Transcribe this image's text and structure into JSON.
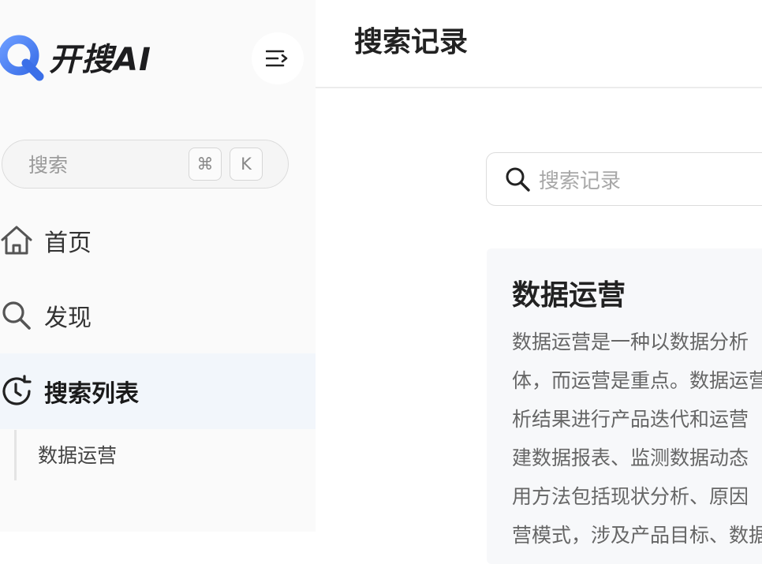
{
  "brand": {
    "name": "开搜AI",
    "accent": "#4a7df0"
  },
  "sidebar": {
    "search": {
      "placeholder": "搜索",
      "shortcut_cmd": "⌘",
      "shortcut_key": "K"
    },
    "nav": [
      {
        "label": "首页",
        "icon": "home-icon"
      },
      {
        "label": "发现",
        "icon": "search-icon"
      },
      {
        "label": "搜索列表",
        "icon": "history-icon",
        "active": true
      }
    ],
    "history": [
      {
        "label": "数据运营"
      }
    ]
  },
  "main": {
    "title": "搜索记录",
    "search_placeholder": "搜索记录",
    "cards": [
      {
        "title": "数据运营",
        "lines": [
          "数据运营是一种以数据分析",
          "体，而运营是重点。数据运营",
          "析结果进行产品迭代和运营",
          "建数据报表、监测数据动态",
          "用方法包括现状分析、原因",
          "营模式，涉及产品目标、数据"
        ]
      }
    ]
  }
}
